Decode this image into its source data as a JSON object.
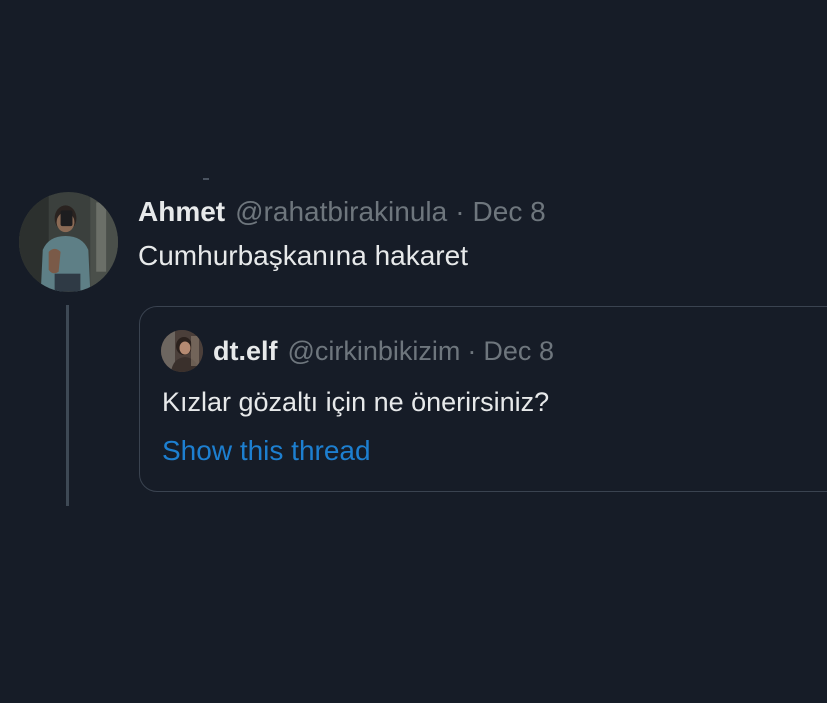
{
  "tweet": {
    "display_name": "Ahmet",
    "handle": "@rahatbirakinula",
    "separator": "·",
    "date": "Dec 8",
    "text": "Cumhurbaşkanına hakaret",
    "avatar_icon": "user-avatar-photo"
  },
  "quoted_tweet": {
    "display_name": "dt.elf",
    "handle": "@cirkinbikizim",
    "separator": "·",
    "date": "Dec 8",
    "text": "Kızlar gözaltı için ne önerirsiniz?",
    "show_thread_label": "Show this thread",
    "avatar_icon": "user-avatar-photo"
  },
  "colors": {
    "background": "#161c27",
    "text_primary": "#e7e9ea",
    "text_secondary": "#6e767d",
    "link": "#1d7fd0",
    "border": "#3a4350"
  }
}
